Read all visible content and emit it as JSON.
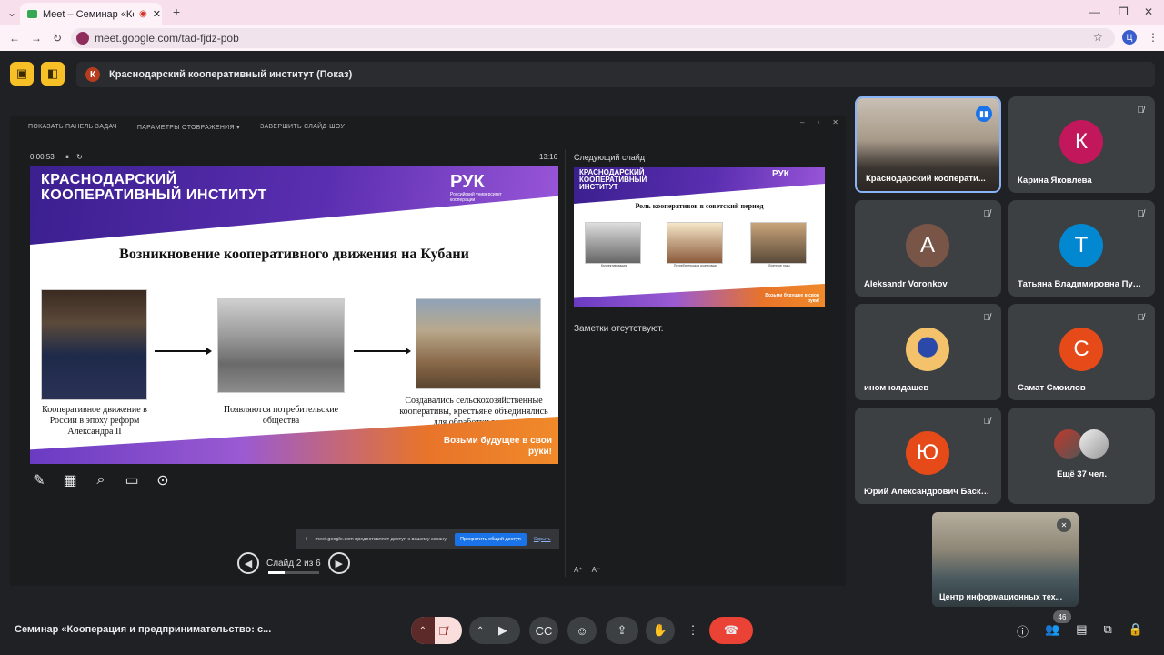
{
  "browser": {
    "tab_title": "Meet – Семинар «Коопер...",
    "url": "meet.google.com/tad-fjdz-pob",
    "profile_initial": "Ц"
  },
  "presentation_bar": {
    "avatar_initial": "К",
    "title": "Краснодарский кооперативный институт (Показ)"
  },
  "presenter": {
    "toolbar": [
      "ПОКАЗАТЬ ПАНЕЛЬ ЗАДАЧ",
      "ПАРАМЕТРЫ ОТОБРАЖЕНИЯ ▾",
      "ЗАВЕРШИТЬ СЛАЙД-ШОУ"
    ],
    "timer": "0:00:53",
    "clock": "13:16",
    "next_slide_label": "Следующий слайд",
    "notes": "Заметки отсутствуют.",
    "slide_counter": "Слайд 2 из 6",
    "slide_progress": 0.33,
    "font_up": "A⁺",
    "font_down": "A⁻"
  },
  "slide": {
    "header": "КРАСНОДАРСКИЙ КООПЕРАТИВНЫЙ ИНСТИТУТ",
    "logo": "РУК",
    "logo_sub": "Российский университет кооперации",
    "title": "Возникновение кооперативного движения на Кубани",
    "captions": [
      "Кооперативное движение в России в эпоху реформ Александра II",
      "Появляются потребительские общества",
      "Создавались сельскохозяйственные кооперативы, крестьяне объединялись для обработки земли"
    ],
    "slogan": "Возьми будущее в свои руки!"
  },
  "next_slide": {
    "header": "КРАСНОДАРСКИЙ КООПЕРАТИВНЫЙ ИНСТИТУТ",
    "logo": "РУК",
    "title": "Роль кооперативов в советский период",
    "captions": [
      "Коллективизация",
      "Потребительская кооперация",
      "Военные годы"
    ],
    "slogan": "Возьми будущее в свои руки!"
  },
  "share_bar": {
    "text": "meet.google.com предоставляет доступ к вашему экрану.",
    "stop_label": "Прекратить общий доступ",
    "hide_label": "Скрыть"
  },
  "participants": [
    {
      "name": "Краснодарский кооперати...",
      "initial": "",
      "color": "",
      "video": true
    },
    {
      "name": "Карина Яковлева",
      "initial": "К",
      "color": "#c2185b"
    },
    {
      "name": "Aleksandr Voronkov",
      "initial": "A",
      "color": "#795548"
    },
    {
      "name": "Татьяна Владимировна Пудк...",
      "initial": "Т",
      "color": "#0288d1"
    },
    {
      "name": "ином юлдашев",
      "initial": "",
      "color": "#f3c26b"
    },
    {
      "name": "Самат Смоилов",
      "initial": "С",
      "color": "#e64a19"
    },
    {
      "name": "Юрий Александрович Баска...",
      "initial": "Ю",
      "color": "#e64a19"
    },
    {
      "name": "Ещё 37 чел.",
      "initial": "",
      "color": ""
    }
  ],
  "self_view": {
    "name": "Центр информационных тех..."
  },
  "meeting": {
    "title": "Семинар «Кооперация и предпринимательство: с...",
    "participant_count": "46"
  }
}
